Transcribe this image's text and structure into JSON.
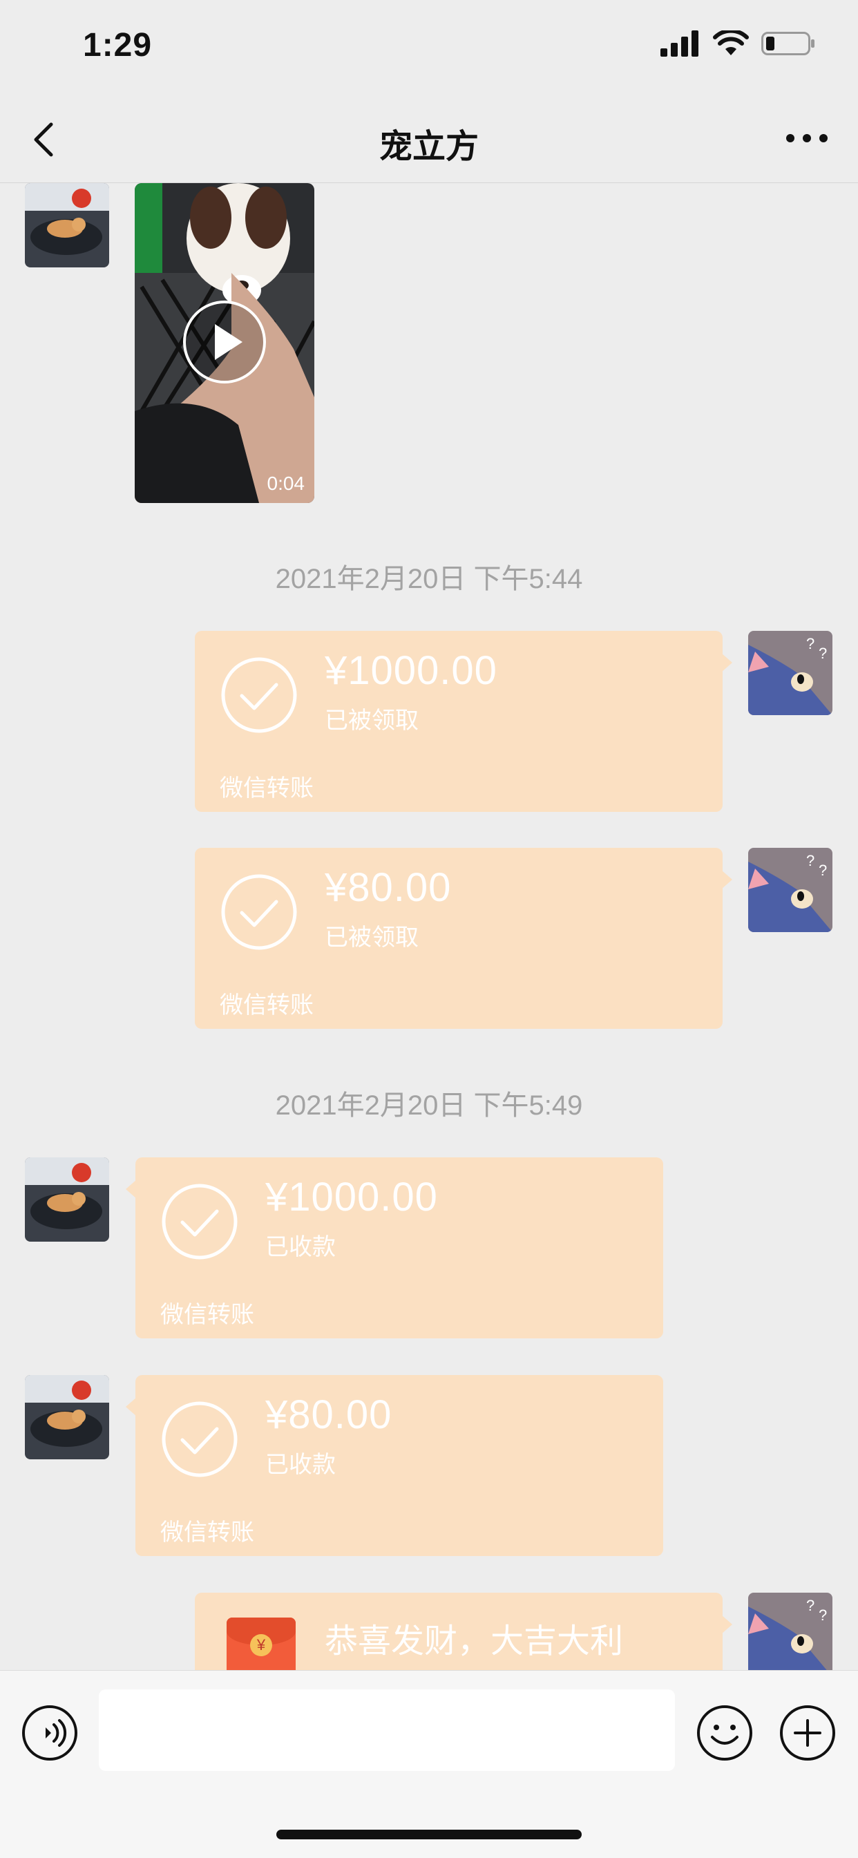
{
  "status_bar": {
    "time": "1:29"
  },
  "header": {
    "title": "宠立方"
  },
  "chat": {
    "timestamps": [
      "2021年2月20日 下午5:44",
      "2021年2月20日 下午5:49"
    ],
    "video": {
      "duration": "0:04"
    },
    "transfers": [
      {
        "amount": "¥1000.00",
        "status": "已被领取",
        "footer": "微信转账"
      },
      {
        "amount": "¥80.00",
        "status": "已被领取",
        "footer": "微信转账"
      },
      {
        "amount": "¥1000.00",
        "status": "已收款",
        "footer": "微信转账"
      },
      {
        "amount": "¥80.00",
        "status": "已收款",
        "footer": "微信转账"
      }
    ],
    "red_packet": {
      "text": "恭喜发财，大吉大利",
      "icon_glyph": "¥"
    }
  },
  "input_bar": {
    "placeholder": ""
  },
  "colors": {
    "transfer_bubble": "#fbe0c2",
    "background": "#ededed",
    "red_packet": "#f25c3a"
  }
}
